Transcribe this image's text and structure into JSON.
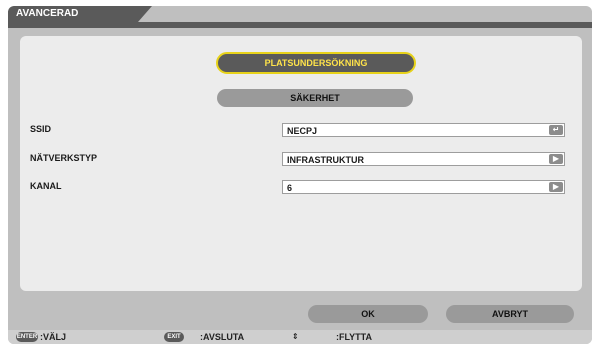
{
  "window": {
    "title": "AVANCERAD"
  },
  "buttons": {
    "site_survey": "PLATSUNDERSÖKNING",
    "security": "SÄKERHET",
    "ok": "OK",
    "cancel": "AVBRYT"
  },
  "fields": [
    {
      "label": "SSID",
      "value": "NECPJ",
      "icon": "enter-icon"
    },
    {
      "label": "NÄTVERKSTYP",
      "value": "INFRASTRUKTUR",
      "icon": "play-right-icon"
    },
    {
      "label": "KANAL",
      "value": "6",
      "icon": "play-right-icon"
    }
  ],
  "footer": {
    "enter_key": "ENTER",
    "enter_label": ":VÄLJ",
    "exit_key": "EXIT",
    "exit_label": ":AVSLUTA",
    "move_icon": "up-down-arrows-icon",
    "move_label": ":FLYTTA"
  },
  "colors": {
    "frame": "#bfbfbf",
    "titlebar": "#5a5a5a",
    "panel": "#ececec",
    "highlight_text": "#ffe34a",
    "highlight_border": "#e7d21a"
  }
}
